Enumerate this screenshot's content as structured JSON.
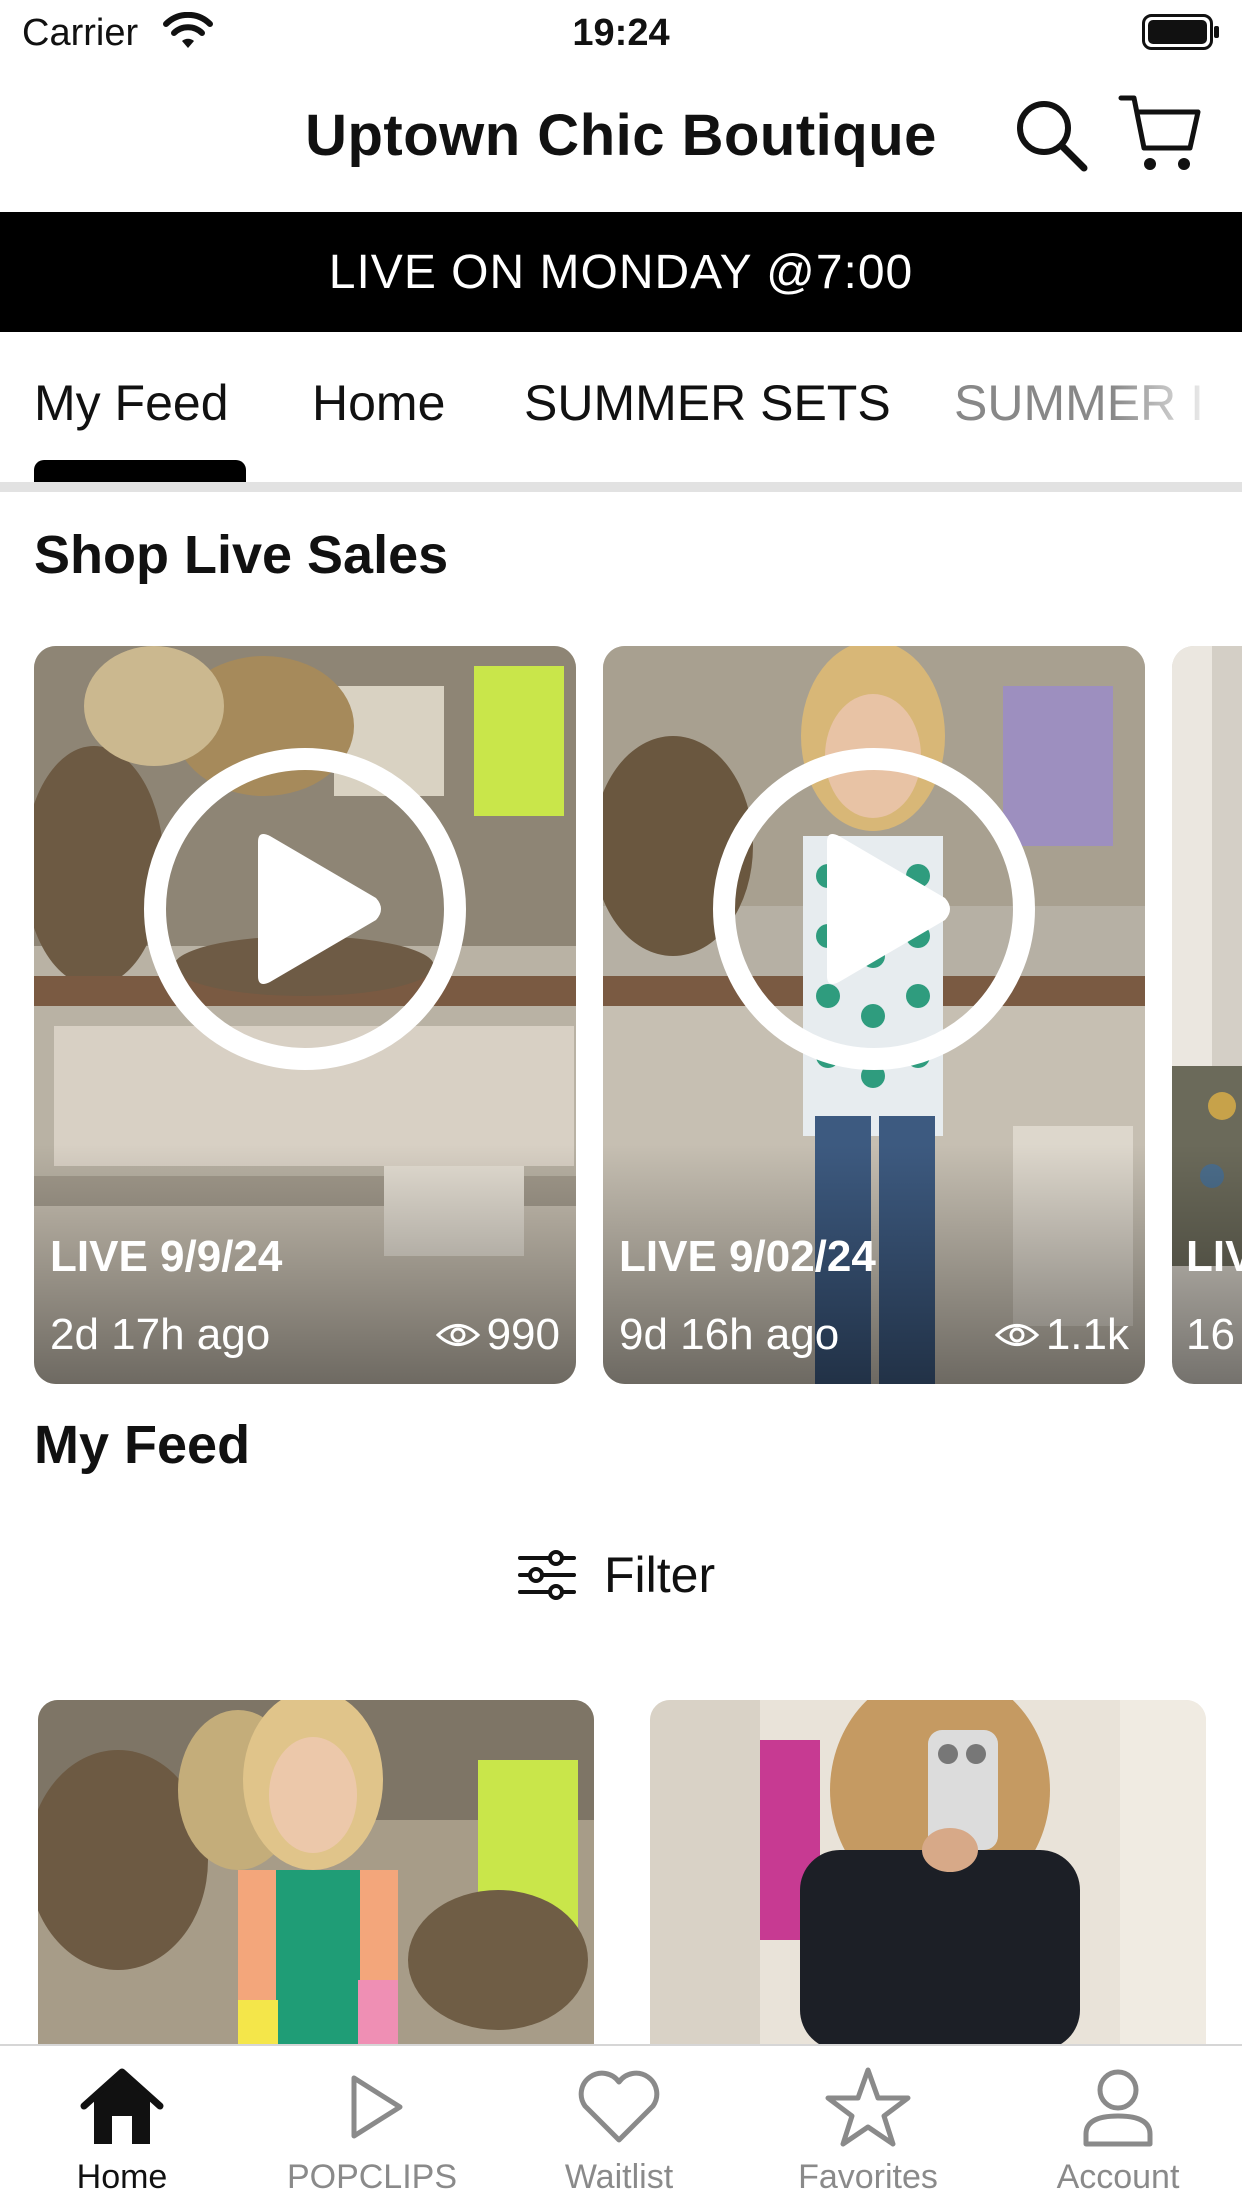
{
  "status_bar": {
    "carrier": "Carrier",
    "time": "19:24"
  },
  "header": {
    "title": "Uptown Chic Boutique"
  },
  "banner": {
    "text": "LIVE ON MONDAY @7:00"
  },
  "tabs": [
    {
      "label": "My Feed",
      "active": true
    },
    {
      "label": "Home",
      "active": false
    },
    {
      "label": "SUMMER SETS",
      "active": false
    },
    {
      "label": "SUMMER I",
      "active": false
    }
  ],
  "live_section": {
    "title": "Shop Live Sales",
    "cards": [
      {
        "label": "LIVE 9/9/24",
        "ago": "2d 17h ago",
        "views": "990"
      },
      {
        "label": "LIVE 9/02/24",
        "ago": "9d 16h ago",
        "views": "1.1k"
      },
      {
        "label": "LIV",
        "ago": "16"
      }
    ]
  },
  "feed_section": {
    "title": "My Feed",
    "filter_label": "Filter"
  },
  "bottom_nav": [
    {
      "label": "Home",
      "icon": "home-icon",
      "active": true
    },
    {
      "label": "POPCLIPS",
      "icon": "play-icon",
      "active": false
    },
    {
      "label": "Waitlist",
      "icon": "heart-icon",
      "active": false
    },
    {
      "label": "Favorites",
      "icon": "star-icon",
      "active": false
    },
    {
      "label": "Account",
      "icon": "person-icon",
      "active": false
    }
  ],
  "colors": {
    "banner_bg": "#000000",
    "active": "#111111",
    "inactive": "#8a8a8a"
  }
}
